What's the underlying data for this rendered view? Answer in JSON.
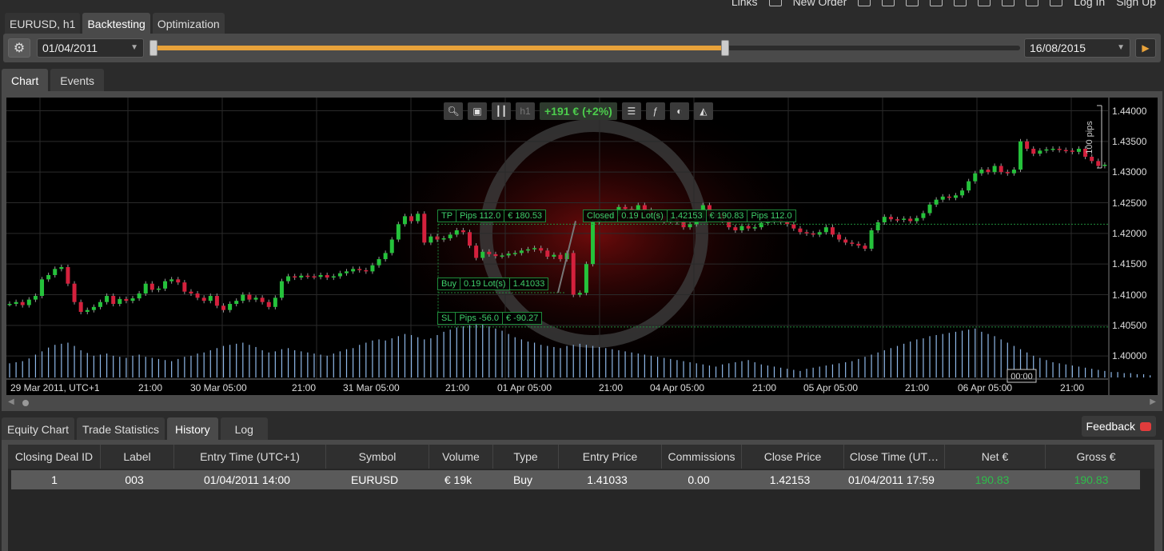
{
  "top_menu": {
    "links": "Links",
    "new_order": "New Order",
    "log_in": "Log In",
    "sign_up": "Sign Up"
  },
  "strategy_tabs": [
    "EURUSD, h1",
    "Backtesting",
    "Optimization"
  ],
  "toolbar": {
    "start_date": "01/04/2011",
    "end_date": "16/08/2015",
    "progress": 0.66,
    "accent": "#e8a23a"
  },
  "chart_tabs": [
    "Chart",
    "Events"
  ],
  "chart_tools": {
    "profit": "+191 € (+2%)",
    "timeframe": "h1"
  },
  "chart_data": {
    "type": "candlestick",
    "x_tick_labels": [
      "29 Mar 2011, UTC+1",
      "21:00",
      "30 Mar 05:00",
      "21:00",
      "31 Mar 05:00",
      "21:00",
      "01 Apr 05:00",
      "21:00",
      "04 Apr 05:00",
      "21:00",
      "05 Apr 05:00",
      "21:00",
      "06 Apr 05:00",
      "21:00"
    ],
    "y_tick_labels": [
      "1.44000",
      "1.43500",
      "1.43000",
      "1.42500",
      "1.42000",
      "1.41500",
      "1.41000",
      "1.40500",
      "1.40000"
    ],
    "ylim": [
      1.3965,
      1.4415
    ],
    "cursor_label": "00:00",
    "scale_label": "100 pips",
    "close": [
      1.4085,
      1.4088,
      1.4083,
      1.4092,
      1.4098,
      1.4125,
      1.4132,
      1.4142,
      1.4145,
      1.4118,
      1.4088,
      1.4072,
      1.4075,
      1.408,
      1.4088,
      1.4098,
      1.4085,
      1.4093,
      1.409,
      1.4094,
      1.4102,
      1.4118,
      1.4108,
      1.411,
      1.4122,
      1.4125,
      1.412,
      1.4105,
      1.4102,
      1.4095,
      1.409,
      1.4098,
      1.4082,
      1.4075,
      1.4085,
      1.409,
      1.41,
      1.4092,
      1.4095,
      1.4088,
      1.408,
      1.4095,
      1.4122,
      1.413,
      1.4128,
      1.4131,
      1.413,
      1.4129,
      1.4132,
      1.4128,
      1.413,
      1.4135,
      1.4138,
      1.4142,
      1.414,
      1.4138,
      1.4148,
      1.4158,
      1.4168,
      1.419,
      1.4215,
      1.4228,
      1.422,
      1.4232,
      1.4185,
      1.4195,
      1.419,
      1.4192,
      1.4198,
      1.4205,
      1.4202,
      1.418,
      1.416,
      1.417,
      1.4166,
      1.4163,
      1.4164,
      1.4167,
      1.4168,
      1.4172,
      1.4174,
      1.4176,
      1.4172,
      1.4162,
      1.4165,
      1.4158,
      1.4168,
      1.41,
      1.4103,
      1.415,
      1.4218,
      1.4222,
      1.4225,
      1.4232,
      1.4243,
      1.424,
      1.4237,
      1.4246,
      1.4238,
      1.4232,
      1.4228,
      1.422,
      1.4224,
      1.4218,
      1.421,
      1.4215,
      1.4225,
      1.4246,
      1.4228,
      1.4232,
      1.4221,
      1.421,
      1.4205,
      1.4212,
      1.4208,
      1.421,
      1.4217,
      1.422,
      1.4222,
      1.4218,
      1.4215,
      1.4208,
      1.4202,
      1.42,
      1.4198,
      1.4202,
      1.421,
      1.4198,
      1.419,
      1.4185,
      1.4183,
      1.418,
      1.4175,
      1.4205,
      1.4218,
      1.4227,
      1.4223,
      1.4222,
      1.4224,
      1.422,
      1.4225,
      1.4233,
      1.4247,
      1.4255,
      1.426,
      1.4258,
      1.4262,
      1.427,
      1.4285,
      1.4298,
      1.4304,
      1.43,
      1.431,
      1.43,
      1.4298,
      1.4304,
      1.435,
      1.4338,
      1.433,
      1.4335,
      1.4337,
      1.4338,
      1.4336,
      1.4335,
      1.4333,
      1.4338,
      1.4325,
      1.4318,
      1.431,
      1.4312
    ],
    "volume": [
      26,
      28,
      30,
      35,
      42,
      48,
      55,
      60,
      62,
      64,
      58,
      50,
      45,
      40,
      42,
      44,
      40,
      38,
      36,
      40,
      42,
      38,
      36,
      34,
      32,
      30,
      34,
      38,
      40,
      44,
      46,
      50,
      54,
      58,
      60,
      62,
      64,
      60,
      56,
      50,
      46,
      48,
      52,
      54,
      50,
      48,
      46,
      44,
      42,
      40,
      44,
      48,
      52,
      54,
      60,
      64,
      68,
      70,
      68,
      72,
      76,
      80,
      78,
      74,
      70,
      72,
      78,
      84,
      88,
      92,
      94,
      96,
      100,
      98,
      94,
      90,
      86,
      80,
      74,
      70,
      66,
      64,
      60,
      58,
      56,
      54,
      58,
      60,
      62,
      60,
      58,
      56,
      54,
      52,
      50,
      48,
      46,
      44,
      42,
      40,
      38,
      36,
      34,
      32,
      30,
      28,
      26,
      24,
      22,
      20,
      24,
      26,
      28,
      30,
      32,
      28,
      24,
      22,
      20,
      18,
      16,
      14,
      12,
      16,
      18,
      20,
      22,
      24,
      26,
      28,
      30,
      34,
      38,
      42,
      46,
      50,
      54,
      58,
      62,
      66,
      70,
      72,
      76,
      78,
      80,
      82,
      84,
      86,
      88,
      90,
      84,
      80,
      76,
      70,
      64,
      58,
      52,
      46,
      40,
      36,
      32,
      28,
      26,
      24,
      22,
      20,
      18,
      16,
      14,
      12,
      10,
      10,
      8,
      8,
      6,
      6,
      4
    ]
  },
  "trade_labels": {
    "tp": [
      "TP",
      "Pips 112.0",
      "€ 180.53"
    ],
    "buy": [
      "Buy",
      "0.19 Lot(s)",
      "1.41033"
    ],
    "sl": [
      "SL",
      "Pips -56.0",
      "€ -90.27"
    ],
    "closed": [
      "Closed",
      "0.19 Lot(s)",
      "1.42153",
      "€ 190.83",
      "Pips 112.0"
    ]
  },
  "bottom_tabs": [
    "Equity Chart",
    "Trade Statistics",
    "History",
    "Log"
  ],
  "feedback_label": "Feedback",
  "history": {
    "columns": [
      "Closing Deal ID",
      "Label",
      "Entry Time (UTC+1)",
      "Symbol",
      "Volume",
      "Type",
      "Entry Price",
      "Commissions",
      "Close Price",
      "Close Time (UT…",
      "Net €",
      "Gross €"
    ],
    "rows": [
      [
        "1",
        "003",
        "01/04/2011 14:00",
        "EURUSD",
        "€ 19k",
        "Buy",
        "1.41033",
        "0.00",
        "1.42153",
        "01/04/2011 17:59",
        "190.83",
        "190.83"
      ]
    ]
  },
  "colors": {
    "up": "#25c23b",
    "down": "#d4213d",
    "volume": "#8fb8e8",
    "profit": "#2ebd4a"
  }
}
